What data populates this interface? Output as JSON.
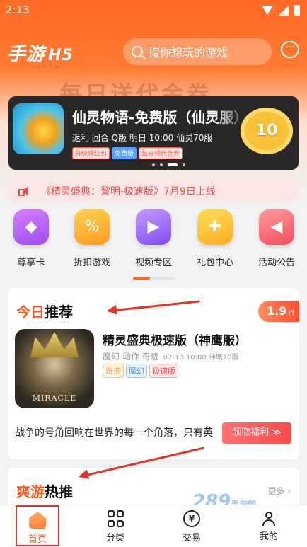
{
  "status_bar": {
    "time": "2:13"
  },
  "header": {
    "logo": "手游",
    "logo_suffix": "H5",
    "search_placeholder": "搜你想玩的游戏",
    "message_icon": "chat-bubble-icon"
  },
  "banner": {
    "background_title": "每日送代金券",
    "game_title": "仙灵物语-免费版（仙灵服）",
    "meta": "返利  回合  Q版  明日 10:00 仙灵70服",
    "tags": [
      "升级领红包",
      "免费版",
      "每日领代金券"
    ],
    "badge_value": "10",
    "page_count": 4,
    "active_page": 3
  },
  "notice": {
    "text": "《精灵盛典：黎明-极速版》7月9日上线"
  },
  "nav": {
    "items": [
      {
        "label": "尊享卡",
        "icon": "diamond-icon",
        "glyph": "◆"
      },
      {
        "label": "折扣游戏",
        "icon": "discount-tag-icon",
        "glyph": "%"
      },
      {
        "label": "视频专区",
        "icon": "video-icon",
        "glyph": "▶"
      },
      {
        "label": "礼包中心",
        "icon": "gift-icon",
        "glyph": "✚"
      },
      {
        "label": "活动公告",
        "icon": "megaphone-icon",
        "glyph": "◀"
      }
    ]
  },
  "today": {
    "title_highlight": "今日",
    "title_rest": "推荐",
    "discount": "1.9",
    "discount_unit": "折",
    "game_title": "精灵盛典极速版（神鹰服）",
    "meta": "魔幻  动作  奇迹",
    "meta_schedule": "07-13 10:00 神鹰10服",
    "tags": [
      "奇迹",
      "魔幻",
      "极速版"
    ],
    "icon_text": "MIRACLE",
    "description": "战争的号角回响在世界的每一个角落，只有英",
    "claim_button": "领取福利 ≫"
  },
  "hot": {
    "title_highlight": "爽游",
    "title_rest": "热推",
    "more": "更多 ›"
  },
  "watermark": {
    "text": "289",
    "sub": "手游网"
  },
  "tabbar": {
    "items": [
      {
        "label": "首页",
        "icon": "home-icon",
        "active": true
      },
      {
        "label": "分类",
        "icon": "category-grid-icon"
      },
      {
        "label": "交易",
        "icon": "trade-coin-icon",
        "glyph": "¥"
      },
      {
        "label": "我的",
        "icon": "user-icon"
      }
    ]
  },
  "colors": {
    "accent": "#ff6a24",
    "annotation": "#e2352a",
    "notice": "#e84c4c"
  }
}
